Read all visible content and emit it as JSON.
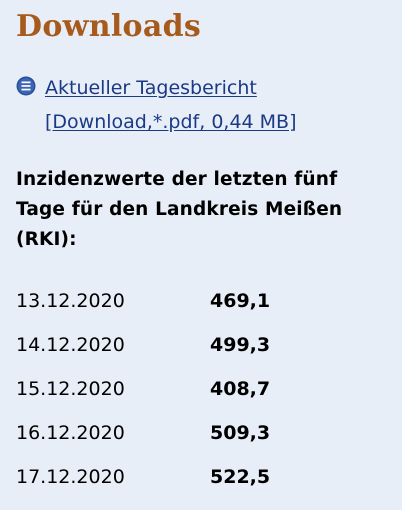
{
  "heading": "Downloads",
  "download": {
    "icon": "document-list-icon",
    "title": "Aktueller Tagesbericht",
    "meta": "[Download,*.pdf, 0,44 MB]"
  },
  "incidence": {
    "intro_lines": [
      "Inzidenzwerte der letzten fünf",
      "Tage für den Landkreis Meißen",
      "(RKI):"
    ],
    "rows": [
      {
        "date": "13.12.2020",
        "value": "469,1"
      },
      {
        "date": "14.12.2020",
        "value": "499,3"
      },
      {
        "date": "15.12.2020",
        "value": "408,7"
      },
      {
        "date": "16.12.2020",
        "value": "509,3"
      },
      {
        "date": "17.12.2020",
        "value": "522,5"
      }
    ]
  },
  "colors": {
    "background": "#e8eef7",
    "heading": "#a65a1c",
    "link": "#1a3a86",
    "icon": "#2a4f97"
  }
}
